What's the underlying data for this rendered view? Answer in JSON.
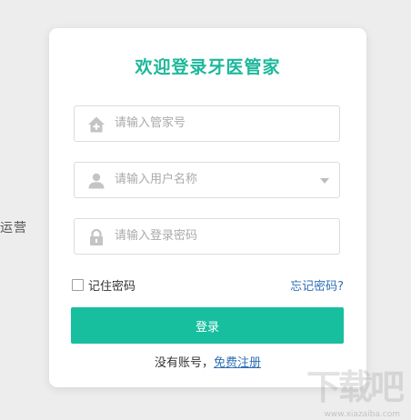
{
  "background": {
    "side_text": "运营"
  },
  "login": {
    "title": "欢迎登录牙医管家",
    "fields": {
      "manager_id": {
        "placeholder": "请输入管家号",
        "icon": "home-icon"
      },
      "username": {
        "placeholder": "请输入用户名称",
        "icon": "user-icon",
        "has_dropdown": true
      },
      "password": {
        "placeholder": "请输入登录密码",
        "icon": "lock-icon"
      }
    },
    "remember_label": "记住密码",
    "forgot_link": "忘记密码?",
    "submit_label": "登录",
    "register_prompt": "没有账号，",
    "register_link": "免费注册"
  },
  "watermark": {
    "logo_text": "下载吧",
    "url": "www.xiazaiba.com"
  },
  "colors": {
    "accent": "#17bf9f",
    "title": "#1cb89a",
    "link": "#2f6fb5",
    "icon": "#c4c4c4"
  }
}
